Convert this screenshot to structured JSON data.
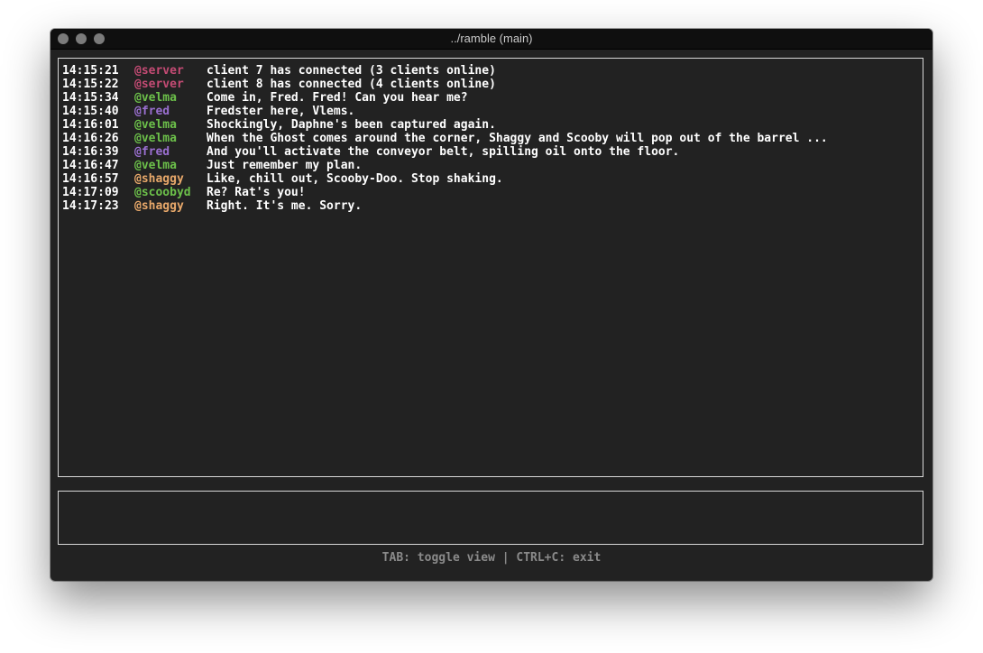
{
  "window": {
    "title": "../ramble (main)"
  },
  "colors": {
    "background": "#222222",
    "text": "#ffffff",
    "border": "#d8d8d8",
    "nick_server": "#c44b74",
    "nick_velma": "#6cc04a",
    "nick_fred": "#9a6fd0",
    "nick_shaggy": "#e8a86a",
    "nick_scoobyd": "#6cc04a",
    "status_text": "#8a8a8a"
  },
  "messages": [
    {
      "time": "14:15:21",
      "nick": "@server",
      "color": "#c44b74",
      "text": "client 7 has connected (3 clients online)"
    },
    {
      "time": "14:15:22",
      "nick": "@server",
      "color": "#c44b74",
      "text": "client 8 has connected (4 clients online)"
    },
    {
      "time": "14:15:34",
      "nick": "@velma",
      "color": "#6cc04a",
      "text": "Come in, Fred. Fred! Can you hear me?"
    },
    {
      "time": "14:15:40",
      "nick": "@fred",
      "color": "#9a6fd0",
      "text": "Fredster here, Vlems."
    },
    {
      "time": "14:16:01",
      "nick": "@velma",
      "color": "#6cc04a",
      "text": "Shockingly, Daphne's been captured again."
    },
    {
      "time": "14:16:26",
      "nick": "@velma",
      "color": "#6cc04a",
      "text": "When the Ghost comes around the corner, Shaggy and Scooby will pop out of the barrel ..."
    },
    {
      "time": "14:16:39",
      "nick": "@fred",
      "color": "#9a6fd0",
      "text": "And you'll activate the conveyor belt, spilling oil onto the floor."
    },
    {
      "time": "14:16:47",
      "nick": "@velma",
      "color": "#6cc04a",
      "text": "Just remember my plan."
    },
    {
      "time": "14:16:57",
      "nick": "@shaggy",
      "color": "#e8a86a",
      "text": "Like, chill out, Scooby-Doo. Stop shaking."
    },
    {
      "time": "14:17:09",
      "nick": "@scoobyd",
      "color": "#6cc04a",
      "text": "Re? Rat's you!"
    },
    {
      "time": "14:17:23",
      "nick": "@shaggy",
      "color": "#e8a86a",
      "text": "Right. It's me. Sorry."
    }
  ],
  "input": {
    "value": "",
    "placeholder": ""
  },
  "statusbar": {
    "text": "TAB: toggle view | CTRL+C: exit"
  }
}
